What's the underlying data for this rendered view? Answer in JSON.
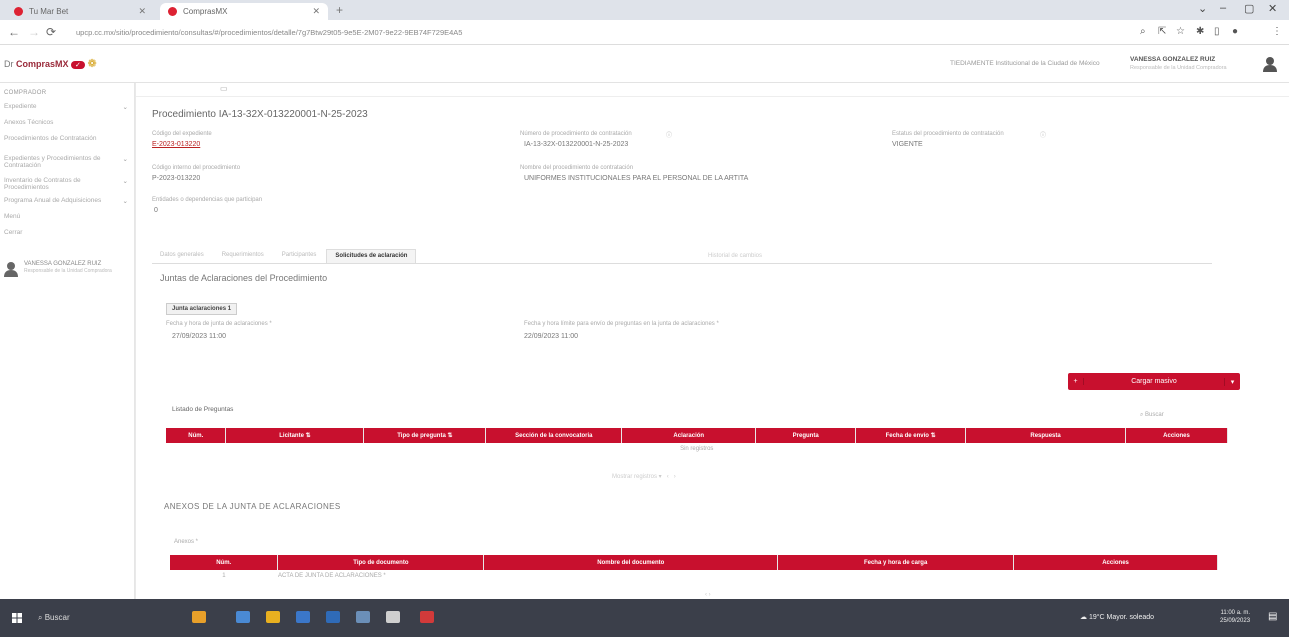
{
  "browser": {
    "tabs": [
      {
        "label": "Tu Mar Bet"
      },
      {
        "label": "ComprasMX"
      }
    ],
    "url": "upcp.cc.mx/sitio/procedimiento/consultas/#/procedimientos/detalle/7g7Btw29t05-9e5E-2M07-9e22-9EB74F729E4A5"
  },
  "app": {
    "logo_prefix": "Dr",
    "logo_name": "ComprasMX",
    "unit_text": "TIEDIAMENTE Institucional de la Ciudad de México",
    "user_name": "VANESSA GONZALEZ RUIZ",
    "user_role": "Responsable de la Unidad Compradora"
  },
  "sidebar": {
    "title": "COMPRADOR",
    "items": [
      {
        "label": "Expediente"
      },
      {
        "label": "Anexos Técnicos"
      },
      {
        "label": "Procedimientos de Contratación"
      },
      {
        "label": "Expedientes y Procedimientos de Contratación"
      },
      {
        "label": "Inventario de Contratos de Procedimientos"
      },
      {
        "label": "Programa Anual de Adquisiciones"
      },
      {
        "label": "Menú"
      },
      {
        "label": "Cerrar"
      }
    ],
    "user": {
      "name": "VANESSA GONZALEZ RUIZ",
      "role": "Responsable de la Unidad Compradora"
    }
  },
  "procedure": {
    "title": "Procedimiento IA-13-32X-013220001-N-25-2023",
    "fields": [
      {
        "label": "Código del expediente",
        "value": "E-2023-013220"
      },
      {
        "label": "Número de procedimiento de contratación",
        "value": "IA-13-32X-013220001-N-25-2023"
      },
      {
        "label": "Estatus del procedimiento de contratación",
        "value": "VIGENTE"
      },
      {
        "label": "Código interno del procedimiento",
        "value": "P-2023-013220"
      },
      {
        "label": "Nombre del procedimiento de contratación",
        "value": "UNIFORMES INSTITUCIONALES PARA EL PERSONAL DE LA ARTITA"
      },
      {
        "label": "Entidades o dependencias que participan",
        "value": "0"
      }
    ]
  },
  "tabs": [
    {
      "label": "Datos generales"
    },
    {
      "label": "Requerimientos"
    },
    {
      "label": "Participantes"
    },
    {
      "label": "Solicitudes de aclaración"
    }
  ],
  "tabs_right": "Historial de cambios",
  "section_title": "Juntas de Aclaraciones del Procedimiento",
  "junta": {
    "button": "Junta aclaraciones 1",
    "date1_label": "Fecha y hora de junta de aclaraciones *",
    "date1_value": "27/09/2023 11:00",
    "date2_label": "Fecha y hora límite para envío de preguntas en la junta de aclaraciones *",
    "date2_value": "22/09/2023 11:00"
  },
  "cargar_button": {
    "plus": "+",
    "label": "Cargar masivo",
    "dropdown": "▾"
  },
  "questions": {
    "title": "Listado de Preguntas",
    "search": "Buscar",
    "headers": [
      "Núm.",
      "Licitante",
      "Tipo de pregunta",
      "Sección de la convocatoria",
      "Aclaración",
      "Pregunta",
      "Fecha de envío",
      "Respuesta",
      "Acciones"
    ],
    "empty": "Sin registros",
    "pager": "Mostrar registros"
  },
  "anexos": {
    "title": "ANEXOS DE LA JUNTA DE ACLARACIONES",
    "label": "Anexos *",
    "headers": [
      "Núm.",
      "Tipo de documento",
      "Nombre del documento",
      "Fecha y hora de carga",
      "Acciones"
    ],
    "row_num": "1",
    "row_text": "ACTA DE JUNTA DE ACLARACIONES *"
  },
  "taskbar": {
    "search": "Buscar",
    "tray": "19°C Mayor. soleado",
    "time": "11:00 a. m.",
    "date": "25/09/2023"
  }
}
